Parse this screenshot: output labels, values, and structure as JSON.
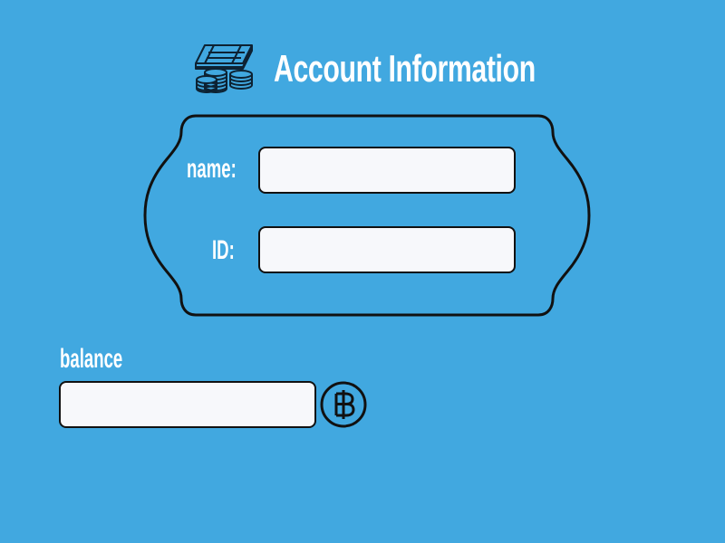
{
  "header": {
    "icon": "money-stack-coins-icon",
    "title": "Account Information"
  },
  "form": {
    "name_label": "name:",
    "name_value": "",
    "id_label": "ID:",
    "id_value": "",
    "balance_label": "balance",
    "balance_value": "",
    "currency_icon": "baht-icon"
  },
  "colors": {
    "background": "#41a8e0",
    "field_background": "#f7f8fb",
    "stroke": "#111111",
    "text": "#ffffff"
  }
}
